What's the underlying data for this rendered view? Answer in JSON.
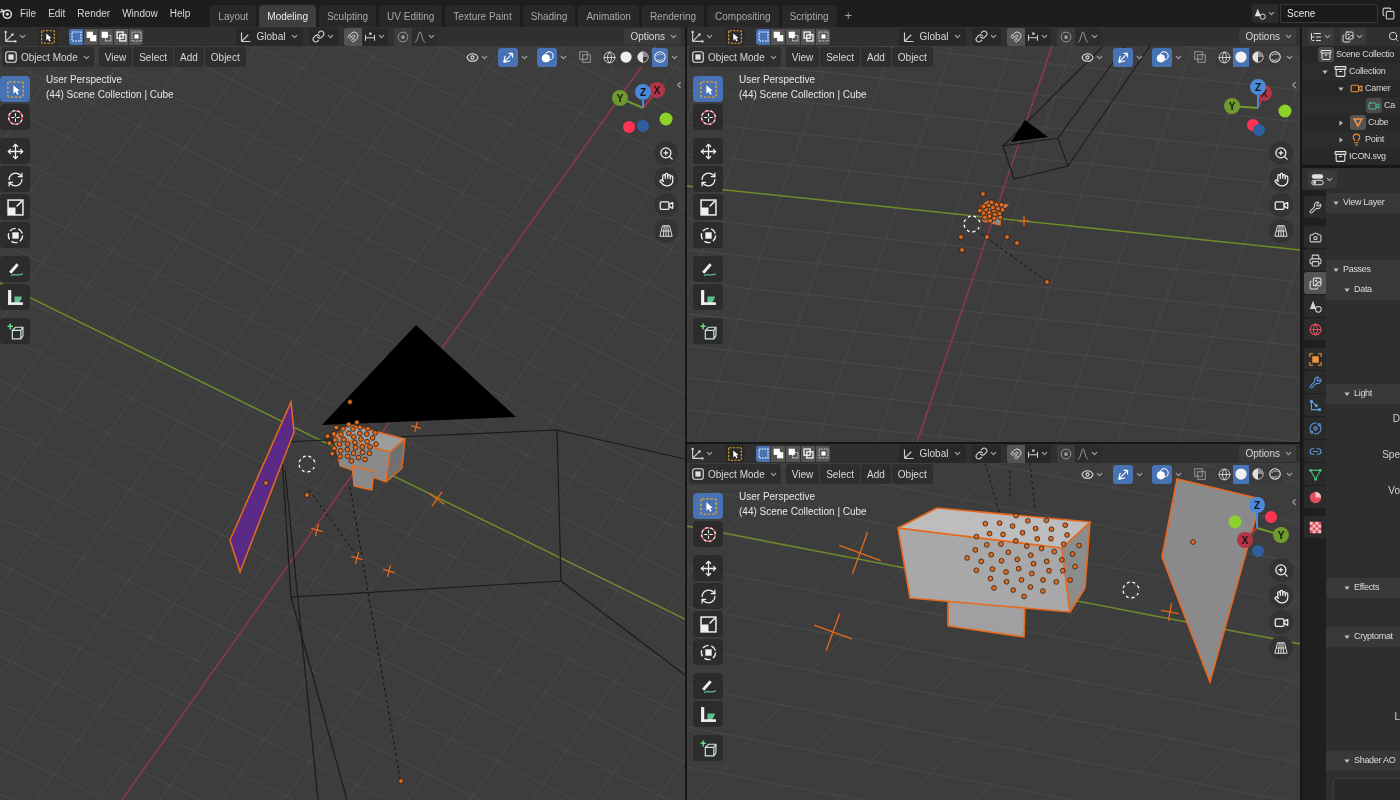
{
  "top_bar": {
    "menus": [
      "File",
      "Edit",
      "Render",
      "Window",
      "Help"
    ],
    "workspaces": [
      {
        "label": "Layout",
        "selected": false
      },
      {
        "label": "Modeling",
        "selected": true
      },
      {
        "label": "Sculpting",
        "selected": false
      },
      {
        "label": "UV Editing",
        "selected": false
      },
      {
        "label": "Texture Paint",
        "selected": false
      },
      {
        "label": "Shading",
        "selected": false
      },
      {
        "label": "Animation",
        "selected": false
      },
      {
        "label": "Rendering",
        "selected": false
      },
      {
        "label": "Compositing",
        "selected": false
      },
      {
        "label": "Scripting",
        "selected": false
      }
    ],
    "add_workspace": "+",
    "scene": "Scene"
  },
  "viewports": [
    {
      "tool_settings": {
        "select_modes": [
          {
            "selected": true
          },
          {
            "selected": false
          },
          {
            "selected": false
          },
          {
            "selected": false
          },
          {
            "selected": false
          }
        ],
        "orientation": "Global",
        "options": "Options"
      },
      "header": {
        "mode": "Object Mode",
        "menus": [
          "View",
          "Select",
          "Add",
          "Object"
        ],
        "gizmos_on": true,
        "overlays_on": true,
        "shading": [
          {
            "selected": false
          },
          {
            "selected": false
          },
          {
            "selected": false
          },
          {
            "selected": true
          }
        ]
      },
      "overlay": {
        "view": "User Perspective",
        "context": "(44) Scene Collection | Cube"
      },
      "toolbar": [
        [
          {
            "kind": "select",
            "selected": true
          },
          {
            "kind": "cursor",
            "selected": false
          }
        ],
        [
          {
            "kind": "move",
            "selected": false
          },
          {
            "kind": "rotate",
            "selected": false
          },
          {
            "kind": "scale",
            "selected": false
          },
          {
            "kind": "transform",
            "selected": false
          }
        ],
        [
          {
            "kind": "annotate",
            "selected": false
          },
          {
            "kind": "measure",
            "selected": false
          }
        ],
        [
          {
            "kind": "add_cube",
            "selected": false
          }
        ]
      ],
      "gizmo": {
        "x": "X",
        "y": "Y",
        "z": "Z"
      }
    },
    {
      "tool_settings": {
        "select_modes": [
          {
            "selected": true
          },
          {
            "selected": false
          },
          {
            "selected": false
          },
          {
            "selected": false
          },
          {
            "selected": false
          }
        ],
        "orientation": "Global",
        "options": "Options"
      },
      "header": {
        "mode": "Object Mode",
        "menus": [
          "View",
          "Select",
          "Add",
          "Object"
        ],
        "gizmos_on": true,
        "overlays_on": true,
        "shading": [
          {
            "selected": false
          },
          {
            "selected": true
          },
          {
            "selected": false
          },
          {
            "selected": false
          }
        ]
      },
      "overlay": {
        "view": "User Perspective",
        "context": "(44) Scene Collection | Cube"
      },
      "toolbar": [
        [
          {
            "kind": "select",
            "selected": true
          },
          {
            "kind": "cursor",
            "selected": false
          }
        ],
        [
          {
            "kind": "move",
            "selected": false
          },
          {
            "kind": "rotate",
            "selected": false
          },
          {
            "kind": "scale",
            "selected": false
          },
          {
            "kind": "transform",
            "selected": false
          }
        ],
        [
          {
            "kind": "annotate",
            "selected": false
          },
          {
            "kind": "measure",
            "selected": false
          }
        ],
        [
          {
            "kind": "add_cube",
            "selected": false
          }
        ]
      ],
      "gizmo": {
        "x": "X",
        "y": "Y",
        "z": "Z"
      }
    },
    {
      "tool_settings": {
        "select_modes": [
          {
            "selected": true
          },
          {
            "selected": false
          },
          {
            "selected": false
          },
          {
            "selected": false
          },
          {
            "selected": false
          }
        ],
        "orientation": "Global",
        "options": "Options"
      },
      "header": {
        "mode": "Object Mode",
        "menus": [
          "View",
          "Select",
          "Add",
          "Object"
        ],
        "gizmos_on": true,
        "overlays_on": true,
        "shading": [
          {
            "selected": false
          },
          {
            "selected": true
          },
          {
            "selected": false
          },
          {
            "selected": false
          }
        ]
      },
      "overlay": {
        "view": "User Perspective",
        "context": "(44) Scene Collection | Cube"
      },
      "toolbar": [
        [
          {
            "kind": "select",
            "selected": true
          },
          {
            "kind": "cursor",
            "selected": false
          }
        ],
        [
          {
            "kind": "move",
            "selected": false
          },
          {
            "kind": "rotate",
            "selected": false
          },
          {
            "kind": "scale",
            "selected": false
          },
          {
            "kind": "transform",
            "selected": false
          }
        ],
        [
          {
            "kind": "annotate",
            "selected": false
          },
          {
            "kind": "measure",
            "selected": false
          }
        ],
        [
          {
            "kind": "add_cube",
            "selected": false
          }
        ]
      ],
      "gizmo": {
        "x": "X",
        "y": "Y",
        "z": "Z"
      }
    }
  ],
  "outliner": {
    "items": [
      {
        "kind": "scene_collection",
        "label": "Scene Collectio",
        "children": [
          {
            "kind": "collection",
            "label": "Collection",
            "expanded": true,
            "children": [
              {
                "kind": "camera",
                "label": "Camer",
                "expanded": true,
                "children": [
                  {
                    "kind": "camera_data",
                    "label": "Ca"
                  }
                ]
              },
              {
                "kind": "mesh",
                "label": "Cube",
                "expanded": false
              },
              {
                "kind": "light",
                "label": "Point",
                "expanded": false
              }
            ]
          },
          {
            "kind": "collection",
            "label": "ICON.svg"
          }
        ]
      }
    ]
  },
  "properties": {
    "tabs": [
      [
        {
          "kind": "tool",
          "selected": false
        }
      ],
      [
        {
          "kind": "render",
          "selected": false
        },
        {
          "kind": "output",
          "selected": false
        },
        {
          "kind": "view_layer",
          "selected": true
        },
        {
          "kind": "scene",
          "selected": false
        },
        {
          "kind": "world",
          "selected": false
        }
      ],
      [
        {
          "kind": "object",
          "selected": false
        },
        {
          "kind": "modifiers",
          "selected": false
        },
        {
          "kind": "particles",
          "selected": false
        },
        {
          "kind": "physics",
          "selected": false
        },
        {
          "kind": "constraints",
          "selected": false
        },
        {
          "kind": "data",
          "selected": false
        },
        {
          "kind": "material",
          "selected": false
        }
      ],
      [
        {
          "kind": "texture",
          "selected": false
        }
      ]
    ],
    "panels": [
      {
        "kind": "plain",
        "title": "View Layer",
        "expanded": true
      },
      {
        "kind": "group",
        "title": "Passes",
        "expanded": true,
        "children": [
          {
            "kind": "plain",
            "title": "Data",
            "expanded": true
          },
          {
            "kind": "plain",
            "title": "Light",
            "expanded": true,
            "labels": [
              "D",
              "Spe",
              "Vo"
            ]
          },
          {
            "kind": "plain",
            "title": "Effects",
            "expanded": true
          },
          {
            "kind": "plain",
            "title": "Cryptomat",
            "expanded": true,
            "labels": [
              "L"
            ]
          },
          {
            "kind": "list",
            "title": "Shader AO",
            "expanded": true
          }
        ]
      }
    ]
  }
}
